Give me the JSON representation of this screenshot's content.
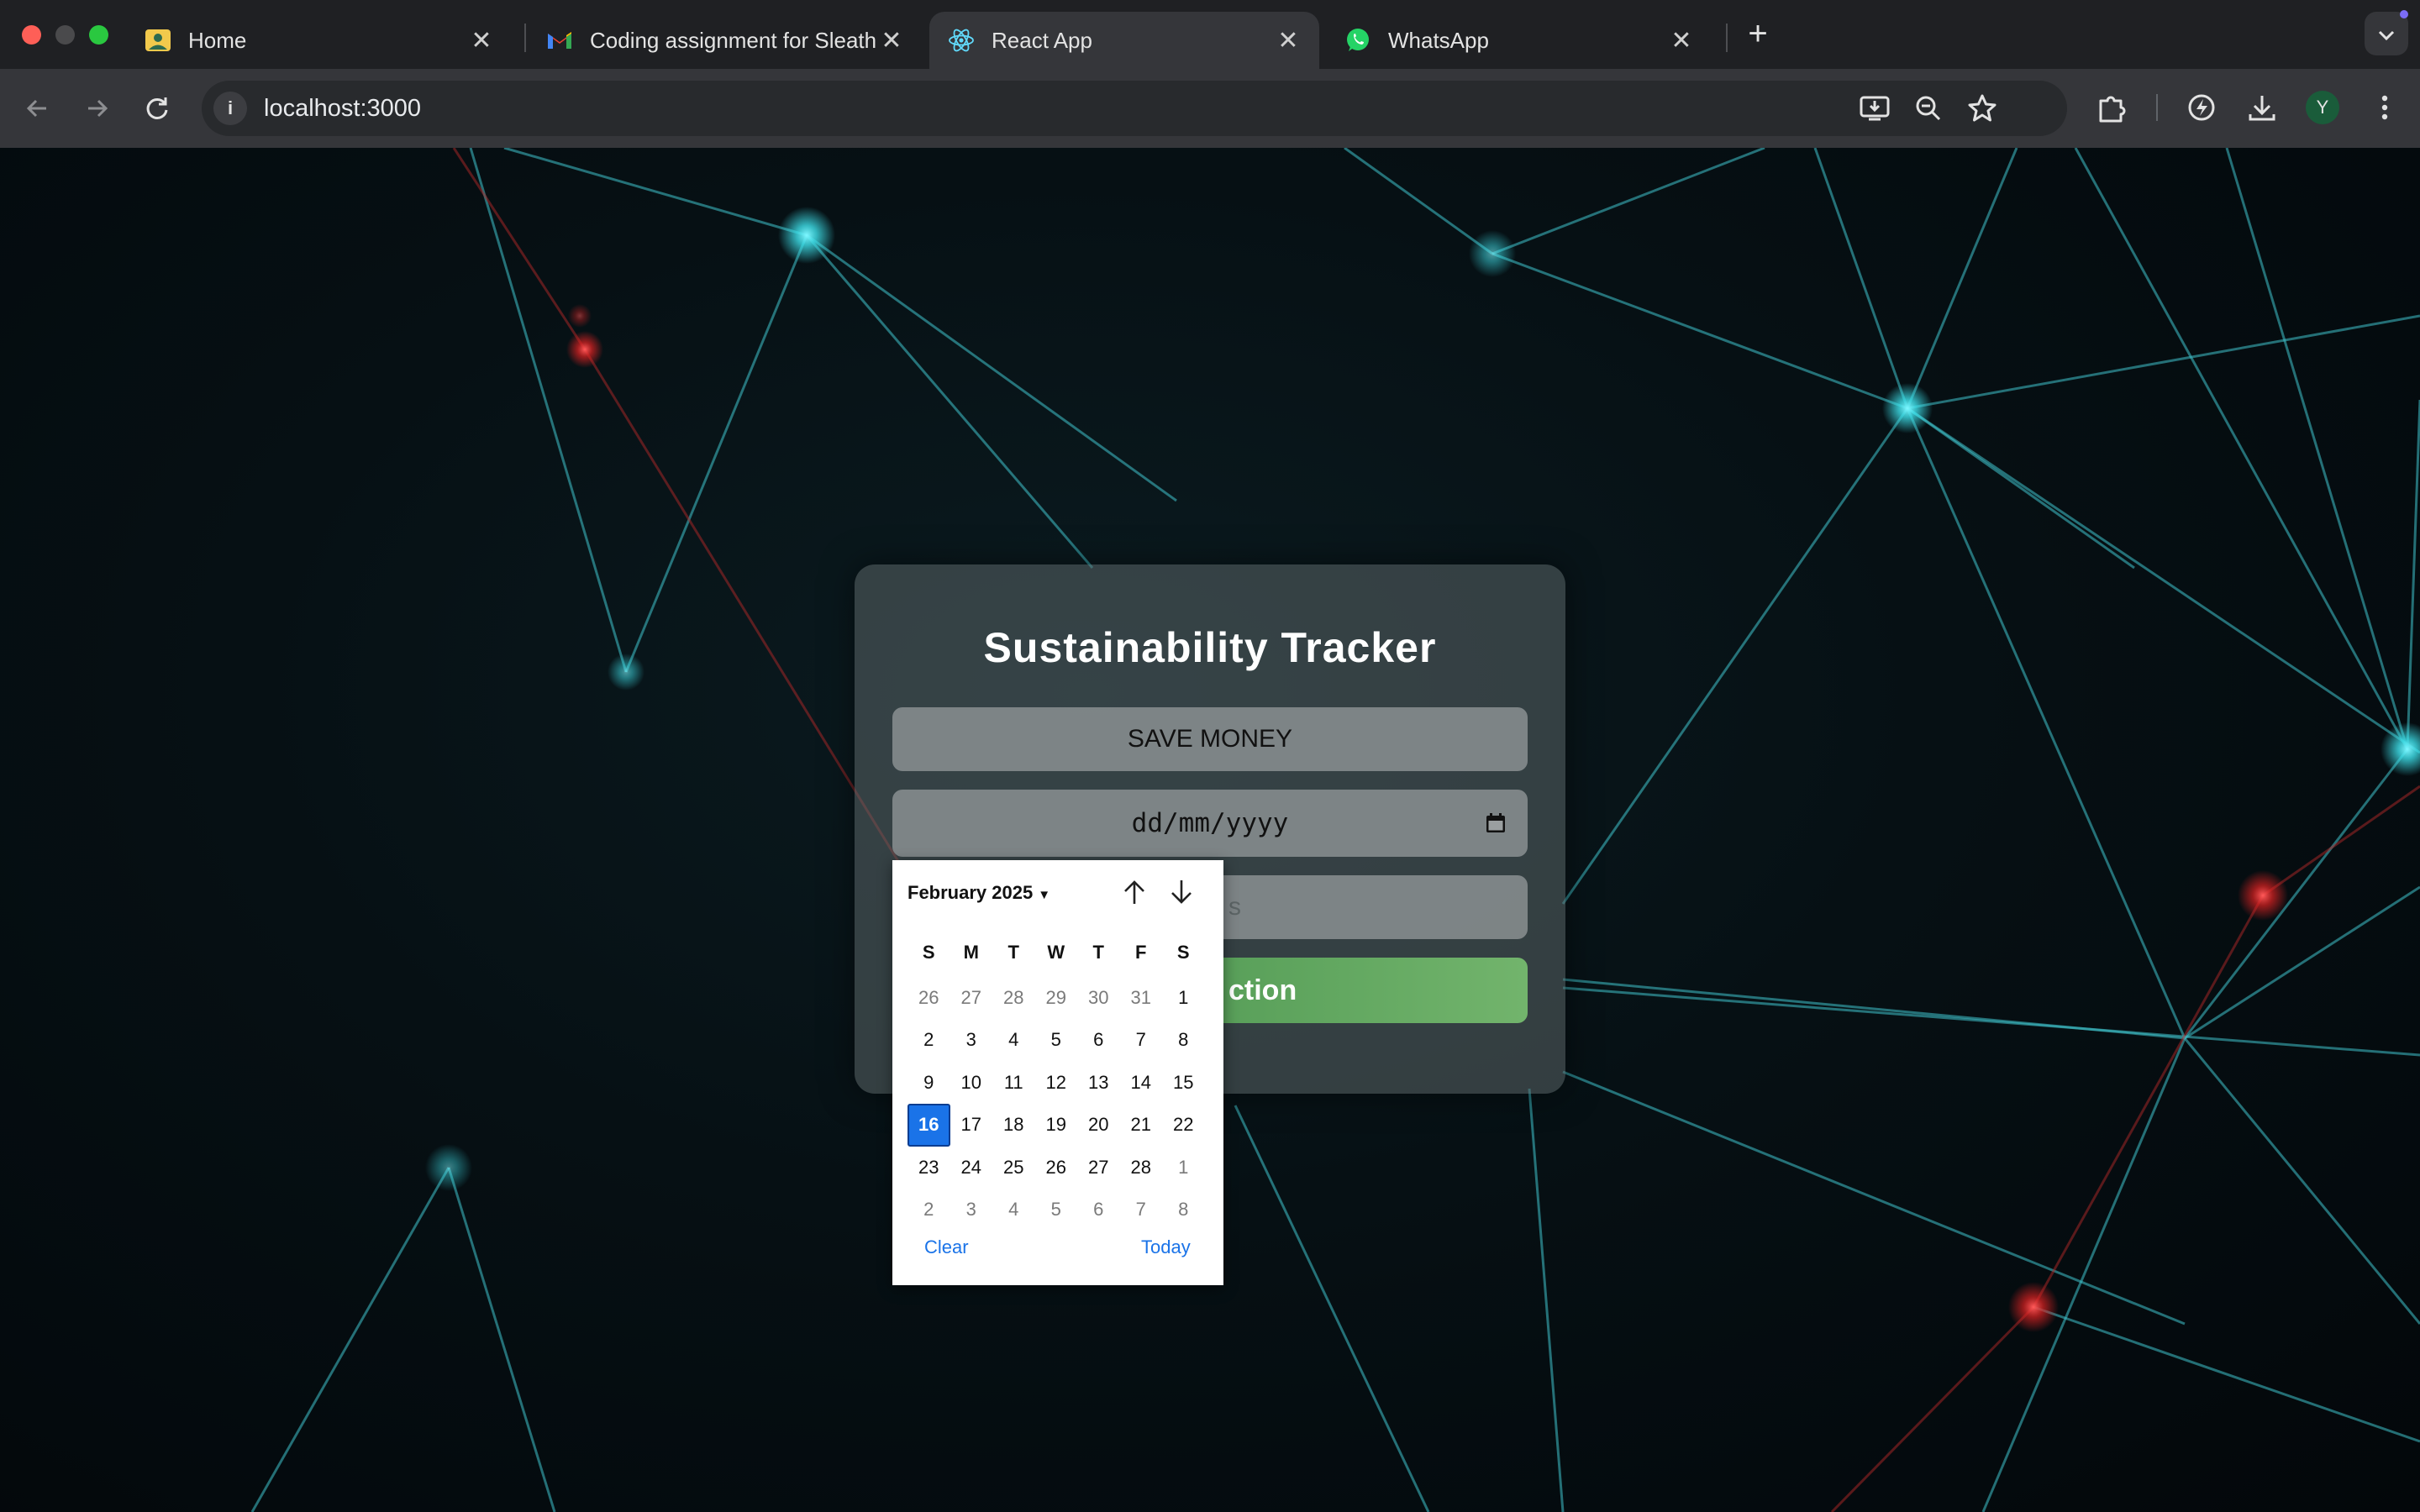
{
  "browser": {
    "tabs": [
      {
        "title": "Home",
        "icon": "photo-app-icon",
        "active": false
      },
      {
        "title": "Coding assignment for Sleath",
        "icon": "gmail-icon",
        "active": false
      },
      {
        "title": "React App",
        "icon": "react-icon",
        "active": true
      },
      {
        "title": "WhatsApp",
        "icon": "whatsapp-icon",
        "active": false
      }
    ],
    "url": "localhost:3000",
    "profile_initial": "Y"
  },
  "form": {
    "title": "Sustainability Tracker",
    "goal_value": "SAVE MONEY",
    "date_placeholder": "dd/mm/yyyy",
    "notes_placeholder_visible": "s",
    "submit_label_visible": "ction"
  },
  "datepicker": {
    "month_label": "February 2025",
    "weekdays": [
      "S",
      "M",
      "T",
      "W",
      "T",
      "F",
      "S"
    ],
    "weeks": [
      [
        {
          "d": "26",
          "dim": true
        },
        {
          "d": "27",
          "dim": true
        },
        {
          "d": "28",
          "dim": true
        },
        {
          "d": "29",
          "dim": true
        },
        {
          "d": "30",
          "dim": true
        },
        {
          "d": "31",
          "dim": true
        },
        {
          "d": "1"
        }
      ],
      [
        {
          "d": "2"
        },
        {
          "d": "3"
        },
        {
          "d": "4"
        },
        {
          "d": "5"
        },
        {
          "d": "6"
        },
        {
          "d": "7"
        },
        {
          "d": "8"
        }
      ],
      [
        {
          "d": "9"
        },
        {
          "d": "10"
        },
        {
          "d": "11"
        },
        {
          "d": "12"
        },
        {
          "d": "13"
        },
        {
          "d": "14"
        },
        {
          "d": "15"
        }
      ],
      [
        {
          "d": "16",
          "selected": true
        },
        {
          "d": "17"
        },
        {
          "d": "18"
        },
        {
          "d": "19"
        },
        {
          "d": "20"
        },
        {
          "d": "21"
        },
        {
          "d": "22"
        }
      ],
      [
        {
          "d": "23"
        },
        {
          "d": "24"
        },
        {
          "d": "25"
        },
        {
          "d": "26"
        },
        {
          "d": "27"
        },
        {
          "d": "28"
        },
        {
          "d": "1",
          "dim": true
        }
      ],
      [
        {
          "d": "2",
          "dim": true
        },
        {
          "d": "3",
          "dim": true
        },
        {
          "d": "4",
          "dim": true
        },
        {
          "d": "5",
          "dim": true
        },
        {
          "d": "6",
          "dim": true
        },
        {
          "d": "7",
          "dim": true
        },
        {
          "d": "8",
          "dim": true
        }
      ]
    ],
    "clear_label": "Clear",
    "today_label": "Today",
    "selected_color": "#1a73e8"
  }
}
